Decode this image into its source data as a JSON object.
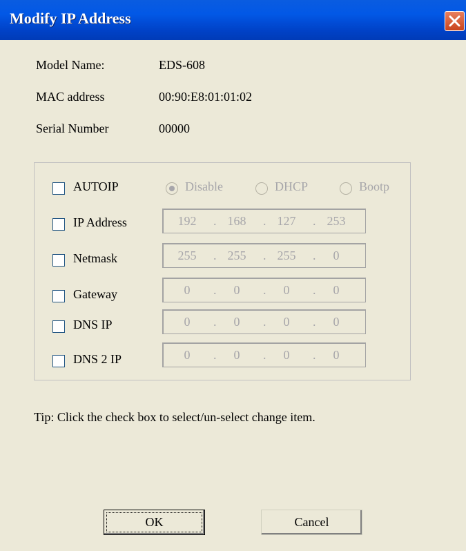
{
  "window": {
    "title": "Modify IP Address"
  },
  "info": [
    {
      "label": "Model Name:",
      "value": "EDS-608"
    },
    {
      "label": "MAC address",
      "value": "00:90:E8:01:01:02"
    },
    {
      "label": "Serial Number",
      "value": "00000"
    }
  ],
  "autoip": {
    "label": "AUTOIP",
    "options": [
      "Disable",
      "DHCP",
      "Bootp"
    ],
    "selected": "Disable"
  },
  "fields": [
    {
      "label": "IP Address",
      "octets": [
        "192",
        "168",
        "127",
        "253"
      ]
    },
    {
      "label": "Netmask",
      "octets": [
        "255",
        "255",
        "255",
        "0"
      ]
    },
    {
      "label": "Gateway",
      "octets": [
        "0",
        "0",
        "0",
        "0"
      ]
    },
    {
      "label": "DNS IP",
      "octets": [
        "0",
        "0",
        "0",
        "0"
      ]
    },
    {
      "label": "DNS 2 IP",
      "octets": [
        "0",
        "0",
        "0",
        "0"
      ]
    }
  ],
  "tip": "Tip: Click the check box to select/un-select change item.",
  "buttons": {
    "ok": "OK",
    "cancel": "Cancel"
  },
  "icons": {
    "close": "close-icon"
  },
  "colors": {
    "titlebar": "#0058e6",
    "close_button": "#d9542b",
    "dialog_bg": "#ece9d8",
    "disabled_text": "#a7a6aa"
  }
}
